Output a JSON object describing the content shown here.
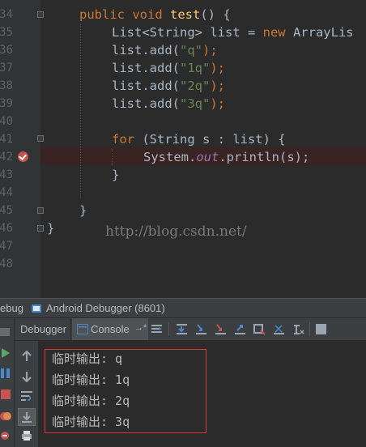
{
  "editor": {
    "line_numbers": [
      "34",
      "35",
      "36",
      "37",
      "38",
      "39",
      "40",
      "41",
      "42",
      "43",
      "44",
      "45",
      "46",
      "47",
      "48"
    ],
    "code": {
      "l34_kw1": "public",
      "l34_kw2": "void",
      "l34_fn": "test",
      "l34_rest": "() {",
      "l35_a": "List<String> list = ",
      "l35_kw": "new",
      "l35_b": " ArrayLis",
      "add_prefix": "list.add(",
      "add_suffix": ");",
      "s1": "\"q\"",
      "s2": "\"1q\"",
      "s3": "\"2q\"",
      "s4": "\"3q\"",
      "l42_kw": "for",
      "l42_rest": " (String s : list) {",
      "l43_a": "System.",
      "l43_field": "out",
      "l43_b": ".println(s);",
      "close_brace": "}"
    },
    "watermark": "http://blog.csdn.net/"
  },
  "debug_panel": {
    "tab_prefix": "ebug",
    "tab_title": "Android Debugger (8601)",
    "tab_debugger": "Debugger",
    "tab_console": "Console",
    "tab_console_suffix": "→*",
    "output_lines": [
      "临时输出: q",
      "临时输出: 1q",
      "临时输出: 2q",
      "临时输出: 3q"
    ]
  },
  "colors": {
    "background": "#2b2b2b",
    "keyword": "#cc7832",
    "string": "#6a8759",
    "breakpoint": "#c75450",
    "output_box": "#d9383a"
  }
}
